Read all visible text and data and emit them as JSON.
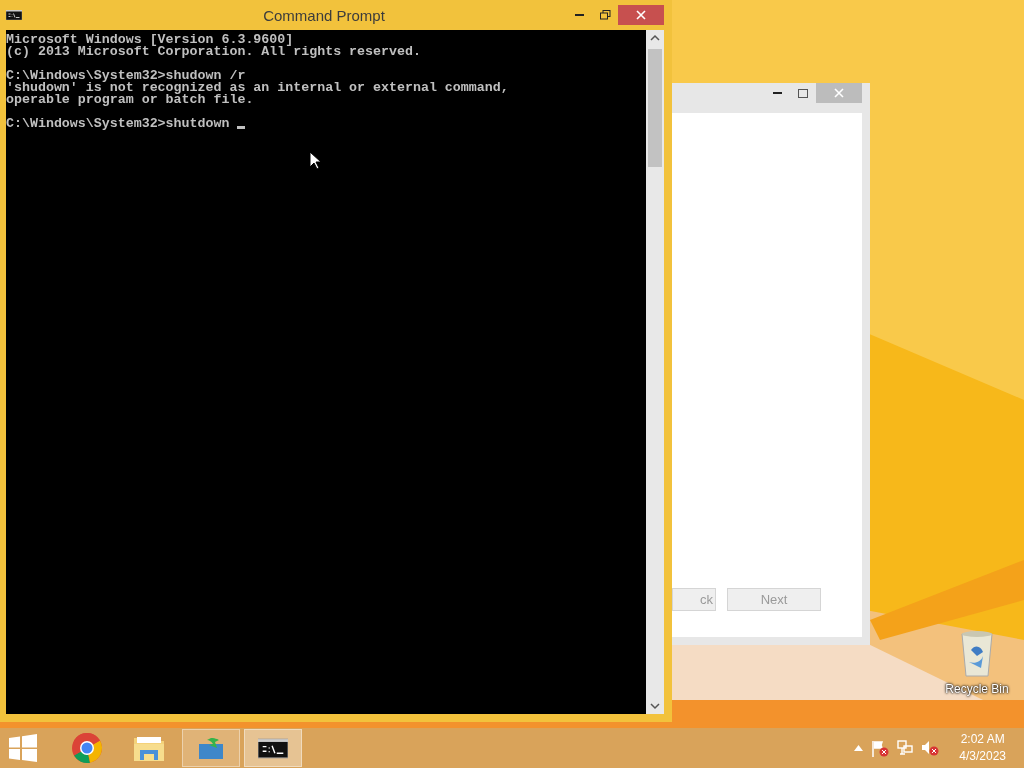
{
  "window": {
    "title": "Command Prompt",
    "console_blocks": [
      [
        "Microsoft Windows [Version 6.3.9600]",
        "(c) 2013 Microsoft Corporation. All rights reserved."
      ],
      [
        "C:\\Windows\\System32>shudown /r",
        "'shudown' is not recognized as an internal or external command,",
        "operable program or batch file."
      ],
      [
        "C:\\Windows\\System32>shutdown "
      ]
    ],
    "cursor": true
  },
  "background_window": {
    "buttons": [
      {
        "label": "ck",
        "disabled": true
      },
      {
        "label": "Next",
        "disabled": true
      }
    ]
  },
  "desktop_icons": [
    {
      "label": "Recycle Bin"
    }
  ],
  "taskbar": {
    "apps": [
      {
        "kind": "start",
        "open": false,
        "selected": false
      },
      {
        "kind": "chrome",
        "open": false,
        "selected": false
      },
      {
        "kind": "explorer",
        "open": false,
        "selected": false
      },
      {
        "kind": "installer",
        "open": true,
        "selected": false
      },
      {
        "kind": "console",
        "open": true,
        "selected": true
      }
    ],
    "tray": [
      {
        "kind": "caret"
      },
      {
        "kind": "flag"
      },
      {
        "kind": "network"
      },
      {
        "kind": "speaker"
      }
    ],
    "time": "2:02 AM",
    "date": "4/3/2023"
  }
}
